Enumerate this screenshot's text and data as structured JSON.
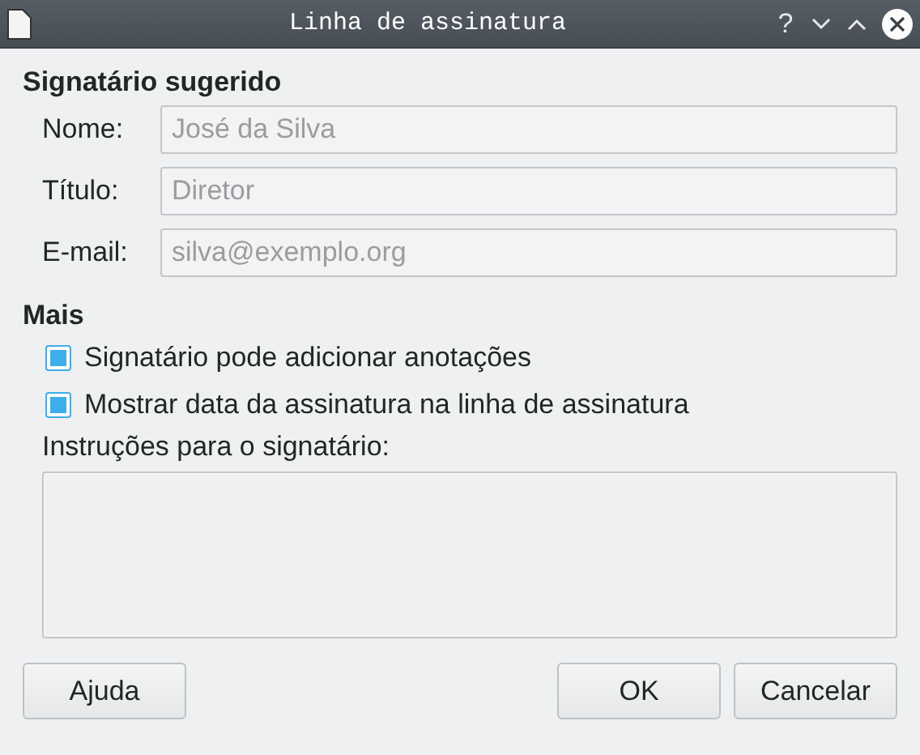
{
  "window": {
    "title": "Linha de assinatura",
    "buttons": [
      {
        "kind": "help",
        "label": "?"
      }
    ]
  },
  "suggested_signer": {
    "heading": "Signatário sugerido",
    "fields": [
      {
        "label": "Nome:",
        "value": "José da Silva",
        "disabled": true
      },
      {
        "label": "Título:",
        "value": "Diretor",
        "disabled": true
      },
      {
        "label": "E-mail:",
        "value": "silva@exemplo.org",
        "disabled": true
      }
    ]
  },
  "more": {
    "heading": "Mais",
    "options": [
      {
        "label": "Signatário pode adicionar anotações",
        "checked": true
      },
      {
        "label": "Mostrar data da assinatura na linha de assinatura",
        "checked": true
      }
    ],
    "instructions": {
      "label": "Instruções para o signatário:"
    }
  },
  "buttons": [
    {
      "label": "Ajuda",
      "kind": "help"
    },
    {
      "label": "OK",
      "kind": "ok"
    },
    {
      "label": "Cancelar",
      "kind": "cancel"
    }
  ]
}
